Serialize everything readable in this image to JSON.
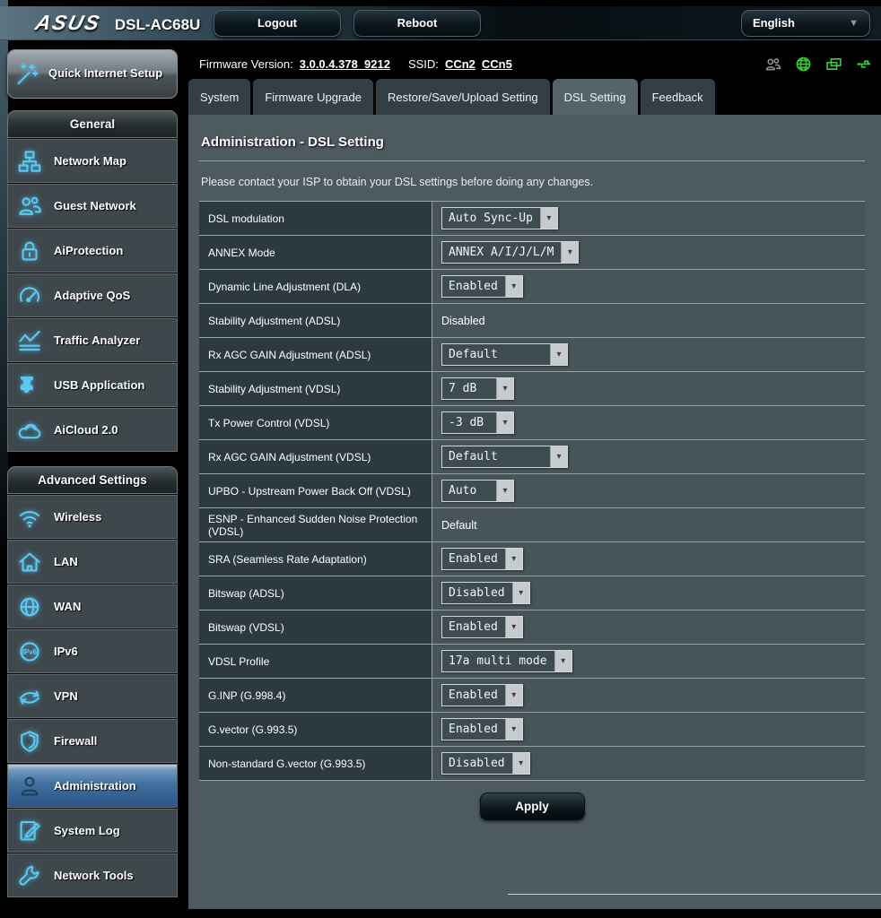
{
  "header": {
    "brand": "ASUS",
    "model": "DSL-AC68U",
    "logout": "Logout",
    "reboot": "Reboot",
    "language": "English"
  },
  "status_bar": {
    "firmware_label": "Firmware Version:",
    "firmware_version": "3.0.0.4.378_9212",
    "ssid_label": "SSID:",
    "ssid1": "CCn2",
    "ssid2": "CCn5",
    "icons": [
      {
        "name": "clients-icon",
        "color": "#8d979c"
      },
      {
        "name": "internet-globe-icon",
        "color": "#35d435"
      },
      {
        "name": "devices-icon",
        "color": "#35d435"
      },
      {
        "name": "usb-icon",
        "color": "#35d435"
      }
    ]
  },
  "tabs": [
    {
      "label": "System",
      "active": false
    },
    {
      "label": "Firmware Upgrade",
      "active": false
    },
    {
      "label": "Restore/Save/Upload Setting",
      "active": false
    },
    {
      "label": "DSL Setting",
      "active": true
    },
    {
      "label": "Feedback",
      "active": false
    }
  ],
  "sidebar": {
    "quick_setup": "Quick Internet Setup",
    "sections": [
      {
        "title": "General",
        "items": [
          {
            "label": "Network Map",
            "icon": "network-map-icon"
          },
          {
            "label": "Guest Network",
            "icon": "guest-network-icon"
          },
          {
            "label": "AiProtection",
            "icon": "lock-icon"
          },
          {
            "label": "Adaptive QoS",
            "icon": "gauge-icon"
          },
          {
            "label": "Traffic Analyzer",
            "icon": "chart-icon"
          },
          {
            "label": "USB Application",
            "icon": "puzzle-icon"
          },
          {
            "label": "AiCloud 2.0",
            "icon": "cloud-icon"
          }
        ]
      },
      {
        "title": "Advanced Settings",
        "items": [
          {
            "label": "Wireless",
            "icon": "wifi-icon"
          },
          {
            "label": "LAN",
            "icon": "house-icon"
          },
          {
            "label": "WAN",
            "icon": "globe-icon"
          },
          {
            "label": "IPv6",
            "icon": "ipv6-icon"
          },
          {
            "label": "VPN",
            "icon": "vpn-arrows-icon"
          },
          {
            "label": "Firewall",
            "icon": "shield-icon"
          },
          {
            "label": "Administration",
            "icon": "person-icon",
            "active": true
          },
          {
            "label": "System Log",
            "icon": "log-icon"
          },
          {
            "label": "Network Tools",
            "icon": "wrench-icon"
          }
        ]
      }
    ]
  },
  "page": {
    "title": "Administration - DSL Setting",
    "description": "Please contact your ISP to obtain your DSL settings before doing any changes.",
    "apply_label": "Apply"
  },
  "settings": [
    {
      "label": "DSL modulation",
      "control": "select",
      "value": "Auto Sync-Up"
    },
    {
      "label": "ANNEX Mode",
      "control": "select",
      "value": "ANNEX A/I/J/L/M"
    },
    {
      "label": "Dynamic Line Adjustment (DLA)",
      "control": "select",
      "value": "Enabled"
    },
    {
      "label": "Stability Adjustment (ADSL)",
      "control": "text",
      "value": "Disabled"
    },
    {
      "label": "Rx AGC GAIN Adjustment (ADSL)",
      "control": "select",
      "value": "Default"
    },
    {
      "label": "Stability Adjustment (VDSL)",
      "control": "select",
      "value": "7 dB"
    },
    {
      "label": "Tx Power Control (VDSL)",
      "control": "select",
      "value": "-3 dB"
    },
    {
      "label": "Rx AGC GAIN Adjustment (VDSL)",
      "control": "select",
      "value": "Default"
    },
    {
      "label": "UPBO - Upstream Power Back Off (VDSL)",
      "control": "select",
      "value": "Auto"
    },
    {
      "label": "ESNP - Enhanced Sudden Noise Protection (VDSL)",
      "control": "text",
      "value": "Default"
    },
    {
      "label": "SRA (Seamless Rate Adaptation)",
      "control": "select",
      "value": "Enabled"
    },
    {
      "label": "Bitswap (ADSL)",
      "control": "select",
      "value": "Disabled"
    },
    {
      "label": "Bitswap (VDSL)",
      "control": "select",
      "value": "Enabled"
    },
    {
      "label": "VDSL Profile",
      "control": "select",
      "value": "17a multi mode"
    },
    {
      "label": "G.INP (G.998.4)",
      "control": "select",
      "value": "Enabled"
    },
    {
      "label": "G.vector (G.993.5)",
      "control": "select",
      "value": "Enabled"
    },
    {
      "label": "Non-standard G.vector (G.993.5)",
      "control": "select",
      "value": "Disabled"
    }
  ],
  "colors": {
    "accent_cyan": "#5ec7ee",
    "active_item_blue": "#416f9f",
    "status_green": "#35d435",
    "panel_bg": "#4d5b61",
    "label_cell_bg": "#2c3940",
    "value_cell_bg": "#47555b"
  }
}
